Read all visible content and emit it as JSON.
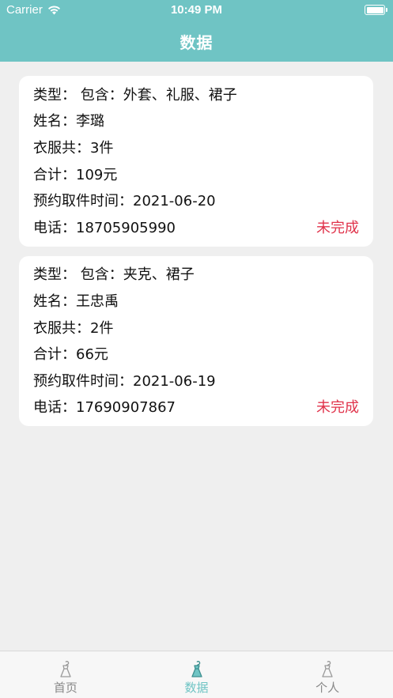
{
  "status_bar": {
    "carrier": "Carrier",
    "time": "10:49 PM"
  },
  "nav": {
    "title": "数据"
  },
  "orders": [
    {
      "type": "类型：  包含：外套、礼服、裙子",
      "name": "姓名：李璐",
      "count": "衣服共：3件",
      "total": "合计：109元",
      "pickup": "预约取件时间：2021-06-20",
      "phone": "电话：18705905990",
      "status": "未完成"
    },
    {
      "type": "类型：  包含：夹克、裙子",
      "name": "姓名：王忠禹",
      "count": "衣服共：2件",
      "total": "合计：66元",
      "pickup": "预约取件时间：2021-06-19",
      "phone": "电话：17690907867",
      "status": "未完成"
    }
  ],
  "tabs": [
    {
      "label": "首页",
      "icon": "hanger-dress-icon",
      "active": false
    },
    {
      "label": "数据",
      "icon": "hanger-dress-icon",
      "active": true
    },
    {
      "label": "个人",
      "icon": "hanger-dress-icon",
      "active": false
    }
  ],
  "colors": {
    "accent": "#6fc4c4",
    "status": "#e0334b",
    "background": "#efefef"
  }
}
